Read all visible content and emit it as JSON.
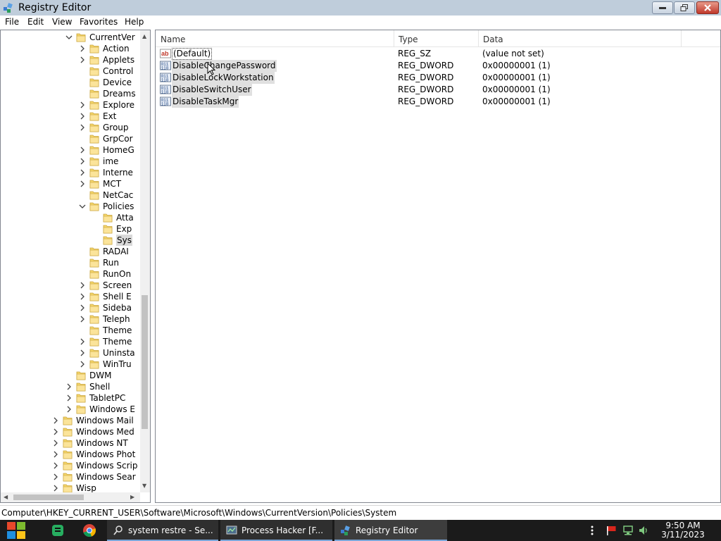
{
  "window": {
    "title": "Registry Editor"
  },
  "menu": [
    "File",
    "Edit",
    "View",
    "Favorites",
    "Help"
  ],
  "tree": {
    "rows": [
      {
        "label": "CurrentVer",
        "depth": 5,
        "expander": "expanded"
      },
      {
        "label": "Action",
        "depth": 6,
        "expander": "collapsed"
      },
      {
        "label": "Applets",
        "depth": 6,
        "expander": "collapsed"
      },
      {
        "label": "Control",
        "depth": 6,
        "expander": "none"
      },
      {
        "label": "Device",
        "depth": 6,
        "expander": "none"
      },
      {
        "label": "Dreams",
        "depth": 6,
        "expander": "none"
      },
      {
        "label": "Explore",
        "depth": 6,
        "expander": "collapsed"
      },
      {
        "label": "Ext",
        "depth": 6,
        "expander": "collapsed"
      },
      {
        "label": "Group",
        "depth": 6,
        "expander": "collapsed"
      },
      {
        "label": "GrpCor",
        "depth": 6,
        "expander": "none"
      },
      {
        "label": "HomeG",
        "depth": 6,
        "expander": "collapsed"
      },
      {
        "label": "ime",
        "depth": 6,
        "expander": "collapsed"
      },
      {
        "label": "Interne",
        "depth": 6,
        "expander": "collapsed"
      },
      {
        "label": "MCT",
        "depth": 6,
        "expander": "collapsed"
      },
      {
        "label": "NetCac",
        "depth": 6,
        "expander": "none"
      },
      {
        "label": "Policies",
        "depth": 6,
        "expander": "expanded"
      },
      {
        "label": "Atta",
        "depth": 7,
        "expander": "none"
      },
      {
        "label": "Exp",
        "depth": 7,
        "expander": "none"
      },
      {
        "label": "Sys",
        "depth": 7,
        "expander": "none",
        "selected": true
      },
      {
        "label": "RADAI",
        "depth": 6,
        "expander": "none"
      },
      {
        "label": "Run",
        "depth": 6,
        "expander": "none"
      },
      {
        "label": "RunOn",
        "depth": 6,
        "expander": "none"
      },
      {
        "label": "Screen",
        "depth": 6,
        "expander": "collapsed"
      },
      {
        "label": "Shell E",
        "depth": 6,
        "expander": "collapsed"
      },
      {
        "label": "Sideba",
        "depth": 6,
        "expander": "collapsed"
      },
      {
        "label": "Teleph",
        "depth": 6,
        "expander": "collapsed"
      },
      {
        "label": "Theme",
        "depth": 6,
        "expander": "none"
      },
      {
        "label": "Theme",
        "depth": 6,
        "expander": "collapsed"
      },
      {
        "label": "Uninsta",
        "depth": 6,
        "expander": "collapsed"
      },
      {
        "label": "WinTru",
        "depth": 6,
        "expander": "collapsed"
      },
      {
        "label": "DWM",
        "depth": 5,
        "expander": "none"
      },
      {
        "label": "Shell",
        "depth": 5,
        "expander": "collapsed"
      },
      {
        "label": "TabletPC",
        "depth": 5,
        "expander": "collapsed"
      },
      {
        "label": "Windows E",
        "depth": 5,
        "expander": "collapsed"
      },
      {
        "label": "Windows Mail",
        "depth": 4,
        "expander": "collapsed"
      },
      {
        "label": "Windows Med",
        "depth": 4,
        "expander": "collapsed"
      },
      {
        "label": "Windows NT",
        "depth": 4,
        "expander": "collapsed"
      },
      {
        "label": "Windows Phot",
        "depth": 4,
        "expander": "collapsed"
      },
      {
        "label": "Windows Scrip",
        "depth": 4,
        "expander": "collapsed"
      },
      {
        "label": "Windows Sear",
        "depth": 4,
        "expander": "collapsed"
      },
      {
        "label": "Wisp",
        "depth": 4,
        "expander": "collapsed"
      }
    ]
  },
  "list": {
    "columns": [
      "Name",
      "Type",
      "Data"
    ],
    "rows": [
      {
        "name": "(Default)",
        "type": "REG_SZ",
        "data": "(value not set)",
        "icon": "string-value-icon"
      },
      {
        "name": "DisableChangePassword",
        "type": "REG_DWORD",
        "data": "0x00000001 (1)",
        "icon": "dword-value-icon"
      },
      {
        "name": "DisableLockWorkstation",
        "type": "REG_DWORD",
        "data": "0x00000001 (1)",
        "icon": "dword-value-icon"
      },
      {
        "name": "DisableSwitchUser",
        "type": "REG_DWORD",
        "data": "0x00000001 (1)",
        "icon": "dword-value-icon"
      },
      {
        "name": "DisableTaskMgr",
        "type": "REG_DWORD",
        "data": "0x00000001 (1)",
        "icon": "dword-value-icon"
      }
    ]
  },
  "status": {
    "path": "Computer\\HKEY_CURRENT_USER\\Software\\Microsoft\\Windows\\CurrentVersion\\Policies\\System"
  },
  "taskbar": {
    "buttons": [
      {
        "label": "system restre - Se...",
        "icon": "search-icon"
      },
      {
        "label": "Process Hacker [F...",
        "icon": "process-hacker-icon"
      },
      {
        "label": "Registry Editor",
        "icon": "regedit-icon"
      }
    ],
    "time": "9:50 AM",
    "date": "3/11/2023"
  }
}
